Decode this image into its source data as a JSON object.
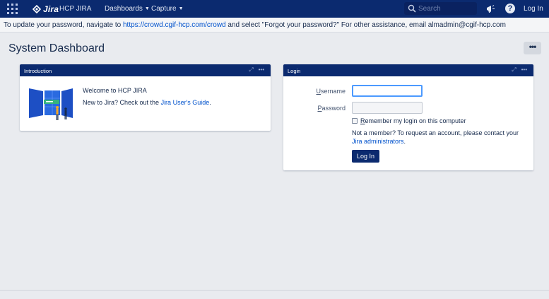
{
  "nav": {
    "logo_text": "Jira",
    "site_name": "HCP JIRA",
    "menus": [
      "Dashboards",
      "Capture"
    ],
    "search_placeholder": "Search",
    "login_label": "Log In",
    "help_label": "?"
  },
  "announcement": {
    "before": "To update your password, navigate to ",
    "link": "https://crowd.cgif-hcp.com/crowd",
    "after": " and select \"Forgot your password?\" For other assistance, email almadmin@cgif-hcp.com"
  },
  "page": {
    "title": "System Dashboard",
    "more_label": "•••"
  },
  "intro_gadget": {
    "header": "Introduction",
    "welcome": "Welcome to HCP JIRA",
    "newto_before": "New to Jira? Check out the ",
    "newto_link": "Jira User's Guide",
    "newto_after": "."
  },
  "login_gadget": {
    "header": "Login",
    "username_label_u": "U",
    "username_label_rest": "sername",
    "password_label_u": "P",
    "password_label_rest": "assword",
    "username_value": "",
    "password_value": "",
    "remember_u": "R",
    "remember_rest": "emember my login on this computer",
    "notmember_before": "Not a member? To request an account, please contact your ",
    "notmember_link": "Jira administrators",
    "notmember_after": ".",
    "button_label": "Log In"
  },
  "colors": {
    "nav_bg": "#0b2a6f",
    "link": "#0052cc",
    "focus": "#4c9aff"
  }
}
